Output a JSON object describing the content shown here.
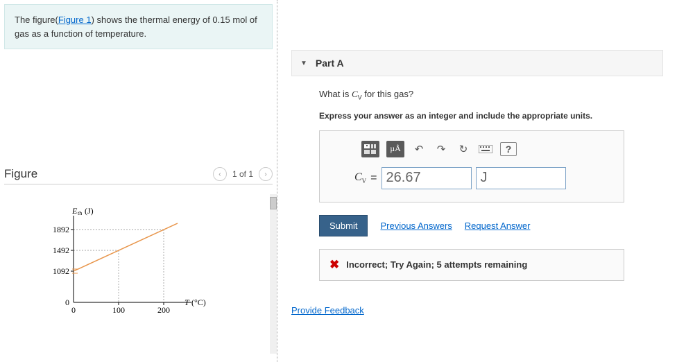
{
  "problem": {
    "pre": "The figure(",
    "link": "Figure 1",
    "post": ") shows the thermal energy of 0.15 mol of gas as a function of temperature."
  },
  "figure": {
    "title": "Figure",
    "nav_text": "1 of 1"
  },
  "chart_data": {
    "type": "line",
    "xlabel": "T (°C)",
    "ylabel": "Eth (J)",
    "x": [
      0,
      100,
      200
    ],
    "y": [
      1092,
      1492,
      1892
    ],
    "xlim": [
      0,
      260
    ],
    "ylim": [
      0,
      2000
    ],
    "xticks": [
      0,
      100,
      200
    ],
    "yticks": [
      0,
      1092,
      1492,
      1892
    ]
  },
  "part": {
    "label": "Part A",
    "question_pre": "What is ",
    "question_var": "C",
    "question_sub": "V",
    "question_post": " for this gas?",
    "instruction": "Express your answer as an integer and include the appropriate units."
  },
  "toolbar": {
    "ua_label": "µÅ",
    "help": "?"
  },
  "answer": {
    "var": "C",
    "sub": "V",
    "eq": " = ",
    "value": "26.67",
    "unit": "J"
  },
  "actions": {
    "submit": "Submit",
    "previous": "Previous Answers",
    "request": "Request Answer"
  },
  "feedback": {
    "text": "Incorrect; Try Again; 5 attempts remaining"
  },
  "provide_feedback": "Provide Feedback"
}
